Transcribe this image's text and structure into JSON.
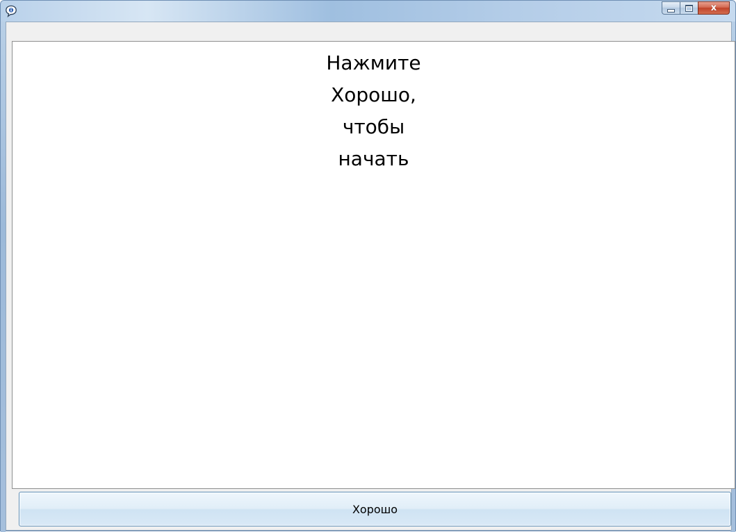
{
  "window": {
    "title": "",
    "app_icon": "info-balloon-icon",
    "controls": {
      "minimize_icon": "minimize-icon",
      "maximize_icon": "maximize-icon",
      "close_icon": "close-icon",
      "close_glyph": "x"
    }
  },
  "prompt": {
    "lines": [
      "Нажмите",
      "Хорошо,",
      "чтобы",
      "начать"
    ]
  },
  "ok_button": {
    "label": "Хорошо"
  },
  "colors": {
    "title_bar": "#a9c4e0",
    "close_button": "#c0432a",
    "button_face": "#e1eef8",
    "button_border": "#5f8fb7",
    "content_background": "#ffffff"
  }
}
